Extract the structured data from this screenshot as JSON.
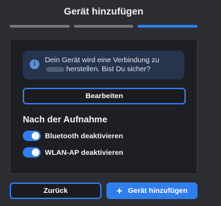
{
  "dialog": {
    "title": "Gerät hinzufügen",
    "steps": [
      {
        "active": false
      },
      {
        "active": false
      },
      {
        "active": true
      }
    ]
  },
  "info": {
    "icon": "info-icon",
    "text_before": "Dein Gerät wird eine Verbindung zu",
    "text_after": "herstellen. Bist Du sicher?"
  },
  "edit_button": {
    "label": "Bearbeiten"
  },
  "after_recording": {
    "title": "Nach der Aufnahme",
    "toggles": [
      {
        "label": "Bluetooth deaktivieren",
        "enabled": true
      },
      {
        "label": "WLAN-AP deaktivieren",
        "enabled": true
      }
    ]
  },
  "footer": {
    "back_label": "Zurück",
    "add_label": "Gerät hinzufügen",
    "add_icon": "plus-icon"
  },
  "colors": {
    "accent": "#2f7ef0",
    "background": "#2b2d31",
    "panel": "#1e1f22",
    "info_bg": "#26344e"
  }
}
